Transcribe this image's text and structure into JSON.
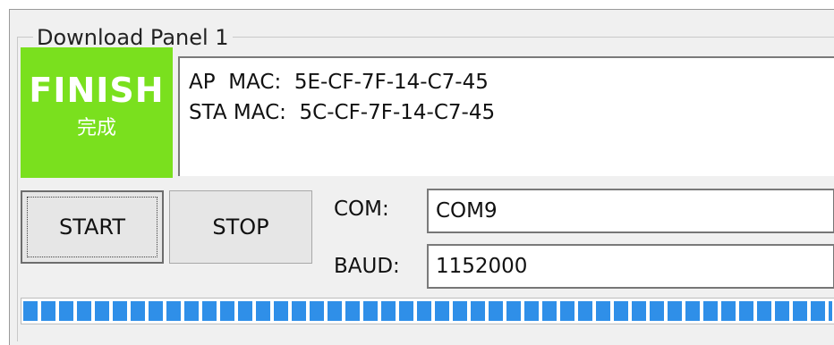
{
  "panel": {
    "title": "Download Panel 1"
  },
  "status": {
    "label_en": "FINISH",
    "label_cn": "完成",
    "color": "#7ae01e"
  },
  "log": {
    "lines": [
      "AP  MAC:  5E-CF-7F-14-C7-45",
      "STA MAC:  5C-CF-7F-14-C7-45"
    ]
  },
  "buttons": {
    "start_label": "START",
    "stop_label": "STOP"
  },
  "com": {
    "label": "COM:",
    "value": "COM9"
  },
  "baud": {
    "label": "BAUD:",
    "value": "1152000"
  },
  "progress": {
    "percent": 100,
    "color": "#2f8fe8"
  }
}
